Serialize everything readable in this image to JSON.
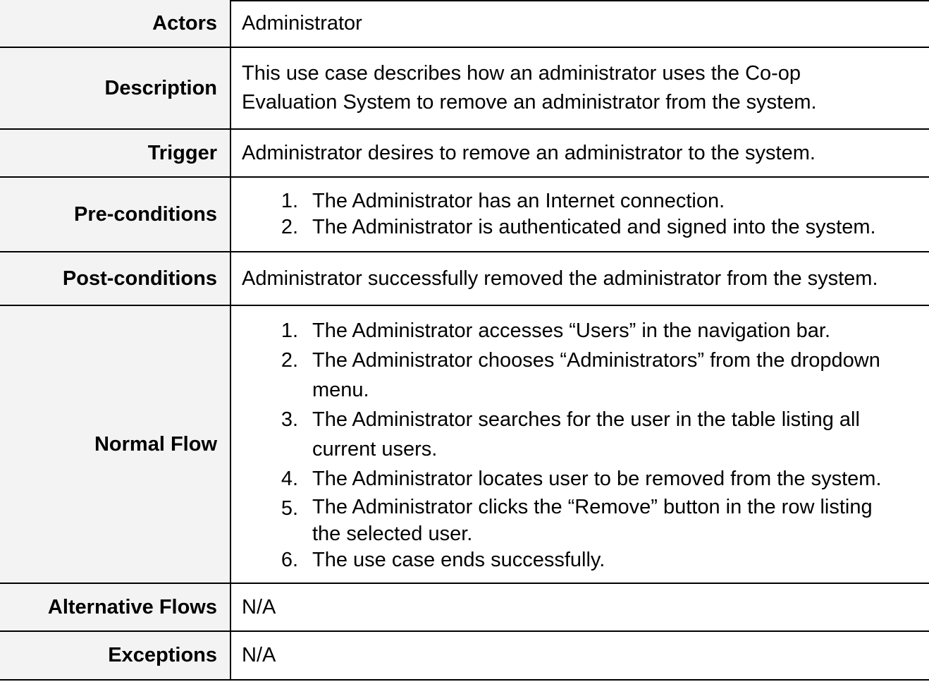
{
  "rows": {
    "actors": {
      "label": "Actors",
      "value": "Administrator"
    },
    "description": {
      "label": "Description",
      "line1": "This use case describes how an administrator uses the Co-op",
      "line2": "Evaluation System to remove an administrator from the system."
    },
    "trigger": {
      "label": "Trigger",
      "value": "Administrator desires to remove an administrator to the system."
    },
    "preconditions": {
      "label": "Pre-conditions",
      "steps": [
        {
          "num": "1.",
          "text": "The Administrator has an Internet connection."
        },
        {
          "num": "2.",
          "text": "The Administrator is authenticated and signed into the system."
        }
      ]
    },
    "postconditions": {
      "label": "Post-conditions",
      "value": "Administrator successfully removed the administrator from the system."
    },
    "normal_flow": {
      "label": "Normal Flow",
      "steps": [
        {
          "num": "1.",
          "line1": "The Administrator accesses “Users” in the navigation bar.",
          "line2": ""
        },
        {
          "num": "2.",
          "line1": "The Administrator chooses “Administrators” from the dropdown",
          "line2": "menu."
        },
        {
          "num": "3.",
          "line1": "The Administrator searches for the user in the table listing all",
          "line2": "current users."
        },
        {
          "num": "4.",
          "line1": "The Administrator locates user to be removed from the system.",
          "line2": ""
        },
        {
          "num": "5.",
          "line1": "The Administrator clicks the “Remove” button in the row listing",
          "line2": "the selected user."
        },
        {
          "num": "6.",
          "line1": "The use case ends successfully.",
          "line2": ""
        }
      ]
    },
    "alternative_flows": {
      "label": "Alternative Flows",
      "value": "N/A"
    },
    "exceptions": {
      "label": "Exceptions",
      "value": "N/A"
    }
  }
}
